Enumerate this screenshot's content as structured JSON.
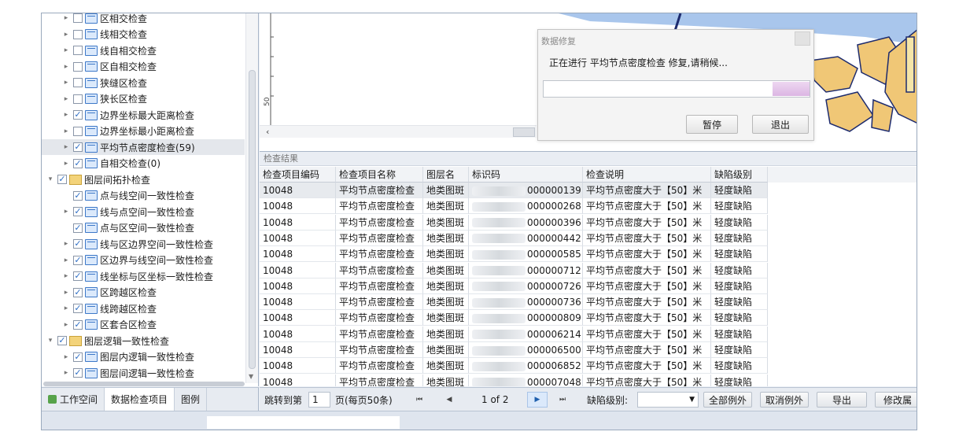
{
  "tree": {
    "items": [
      {
        "label": "区相交检查",
        "checked": false,
        "level": 1,
        "expanded": false,
        "icon": "blue-folder-icon"
      },
      {
        "label": "线相交检查",
        "checked": false,
        "level": 1,
        "expanded": false,
        "icon": "blue-folder-icon"
      },
      {
        "label": "线自相交检查",
        "checked": false,
        "level": 1,
        "expanded": false,
        "icon": "blue-folder-icon"
      },
      {
        "label": "区自相交检查",
        "checked": false,
        "level": 1,
        "expanded": false,
        "icon": "blue-folder-icon"
      },
      {
        "label": "狭缝区检查",
        "checked": false,
        "level": 1,
        "expanded": false,
        "icon": "blue-folder-icon"
      },
      {
        "label": "狭长区检查",
        "checked": false,
        "level": 1,
        "expanded": false,
        "icon": "blue-folder-icon"
      },
      {
        "label": "边界坐标最大距离检查",
        "checked": true,
        "level": 1,
        "expanded": false,
        "icon": "blue-folder-icon"
      },
      {
        "label": "边界坐标最小距离检查",
        "checked": false,
        "level": 1,
        "expanded": false,
        "icon": "blue-folder-icon"
      },
      {
        "label": "平均节点密度检查(59)",
        "checked": true,
        "level": 1,
        "expanded": false,
        "icon": "blue-folder-icon",
        "selected": true
      },
      {
        "label": "自相交检查(0)",
        "checked": true,
        "level": 1,
        "expanded": false,
        "icon": "blue-folder-icon"
      },
      {
        "label": "图层间拓扑检查",
        "checked": true,
        "level": 0,
        "expanded": true,
        "icon": "yellow-folder-icon"
      },
      {
        "label": "点与线空间一致性检查",
        "checked": true,
        "level": 1,
        "expanded": null,
        "icon": "blue-folder-icon"
      },
      {
        "label": "线与点空间一致性检查",
        "checked": true,
        "level": 1,
        "expanded": false,
        "icon": "blue-folder-icon"
      },
      {
        "label": "点与区空间一致性检查",
        "checked": true,
        "level": 1,
        "expanded": null,
        "icon": "blue-folder-icon"
      },
      {
        "label": "线与区边界空间一致性检查",
        "checked": true,
        "level": 1,
        "expanded": false,
        "icon": "blue-folder-icon"
      },
      {
        "label": "区边界与线空间一致性检查",
        "checked": true,
        "level": 1,
        "expanded": false,
        "icon": "blue-folder-icon"
      },
      {
        "label": "线坐标与区坐标一致性检查",
        "checked": true,
        "level": 1,
        "expanded": false,
        "icon": "blue-folder-icon"
      },
      {
        "label": "区跨越区检查",
        "checked": true,
        "level": 1,
        "expanded": false,
        "icon": "blue-folder-icon"
      },
      {
        "label": "线跨越区检查",
        "checked": true,
        "level": 1,
        "expanded": false,
        "icon": "blue-folder-icon"
      },
      {
        "label": "区套合区检查",
        "checked": true,
        "level": 1,
        "expanded": false,
        "icon": "blue-folder-icon"
      },
      {
        "label": "图层逻辑一致性检查",
        "checked": true,
        "level": 0,
        "expanded": true,
        "icon": "yellow-folder-icon"
      },
      {
        "label": "图层内逻辑一致性检查",
        "checked": true,
        "level": 1,
        "expanded": false,
        "icon": "blue-folder-icon"
      },
      {
        "label": "图层间逻辑一致性检查",
        "checked": true,
        "level": 1,
        "expanded": false,
        "icon": "blue-folder-icon"
      }
    ]
  },
  "left_tabs": {
    "workspace": "工作空间",
    "check_items": "数据检查项目",
    "legend": "图例"
  },
  "map": {
    "ruler_label": "50",
    "colors": {
      "polygon_fill": "#f0c776",
      "sea": "#a9c6ec",
      "outline": "#1d2b6e"
    }
  },
  "dialog": {
    "title": "数据修复",
    "message": "正在进行 平均节点密度检查 修复,请稍候...",
    "progress_fraction": 0.14,
    "pause_label": "暂停",
    "exit_label": "退出"
  },
  "results": {
    "section_title": "检查结果",
    "columns": [
      "检查项目编码",
      "检查项目名称",
      "图层名",
      "标识码",
      "检查说明",
      "缺陷级别"
    ],
    "rows": [
      [
        "10048",
        "平均节点密度检查",
        "地类图斑",
        "000000139",
        "平均节点密度大于【50】米",
        "轻度缺陷"
      ],
      [
        "10048",
        "平均节点密度检查",
        "地类图斑",
        "000000268",
        "平均节点密度大于【50】米",
        "轻度缺陷"
      ],
      [
        "10048",
        "平均节点密度检查",
        "地类图斑",
        "000000396",
        "平均节点密度大于【50】米",
        "轻度缺陷"
      ],
      [
        "10048",
        "平均节点密度检查",
        "地类图斑",
        "000000442",
        "平均节点密度大于【50】米",
        "轻度缺陷"
      ],
      [
        "10048",
        "平均节点密度检查",
        "地类图斑",
        "000000585",
        "平均节点密度大于【50】米",
        "轻度缺陷"
      ],
      [
        "10048",
        "平均节点密度检查",
        "地类图斑",
        "000000712",
        "平均节点密度大于【50】米",
        "轻度缺陷"
      ],
      [
        "10048",
        "平均节点密度检查",
        "地类图斑",
        "000000726",
        "平均节点密度大于【50】米",
        "轻度缺陷"
      ],
      [
        "10048",
        "平均节点密度检查",
        "地类图斑",
        "000000736",
        "平均节点密度大于【50】米",
        "轻度缺陷"
      ],
      [
        "10048",
        "平均节点密度检查",
        "地类图斑",
        "000000809",
        "平均节点密度大于【50】米",
        "轻度缺陷"
      ],
      [
        "10048",
        "平均节点密度检查",
        "地类图斑",
        "000006214",
        "平均节点密度大于【50】米",
        "轻度缺陷"
      ],
      [
        "10048",
        "平均节点密度检查",
        "地类图斑",
        "000006500",
        "平均节点密度大于【50】米",
        "轻度缺陷"
      ],
      [
        "10048",
        "平均节点密度检查",
        "地类图斑",
        "000006852",
        "平均节点密度大于【50】米",
        "轻度缺陷"
      ],
      [
        "10048",
        "平均节点密度检查",
        "地类图斑",
        "000007048",
        "平均节点密度大于【50】米",
        "轻度缺陷"
      ]
    ]
  },
  "pager": {
    "jump_label": "跳转到第",
    "page_input": "1",
    "page_suffix": "页(每页50条)",
    "first_icon": "first-page-icon",
    "prev_icon": "prev-page-icon",
    "page_status": "1 of 2",
    "next_icon": "next-page-icon",
    "last_icon": "last-page-icon",
    "defect_label": "缺陷级别:",
    "defect_value": "",
    "exclude_all": "全部例外",
    "cancel_exclude": "取消例外",
    "export": "导出",
    "modify": "修改属"
  }
}
